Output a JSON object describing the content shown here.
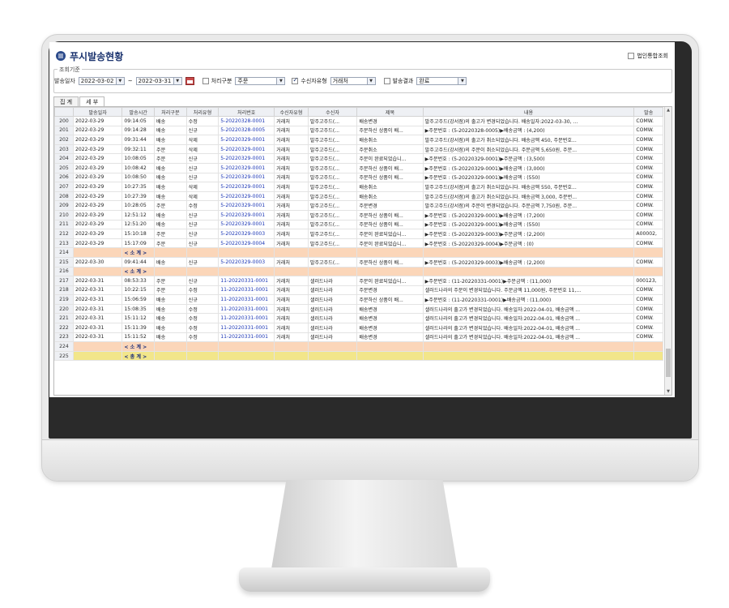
{
  "title": "푸시발송현황",
  "corp_check_label": "법인통합조회",
  "criteria": {
    "legend": "조회기준",
    "send_date_label": "발송일자",
    "date_from": "2022-03-02",
    "date_sep": "~",
    "date_to": "2022-03-31",
    "proc_type_label": "처리구분",
    "proc_type_value": "주문",
    "recipient_type_label": "수신자유형",
    "recipient_type_value": "거래처",
    "result_label": "발송결과",
    "result_value": "완료"
  },
  "tabs": [
    "집 계",
    "세 부"
  ],
  "columns": [
    "",
    "발송일자",
    "발송시간",
    "처리구분",
    "처리유형",
    "처리번호",
    "수신자유형",
    "수신자",
    "제목",
    "내용",
    "발송"
  ],
  "rows": [
    {
      "rn": "200",
      "d": "2022-03-29",
      "t": "09:14:05",
      "pc": "배송",
      "pt": "수정",
      "no": "5-20220328-0001",
      "rt": "거래처",
      "rc": "발주고주드(...",
      "ti": "배송변경",
      "ct": "발주고주드(강서점)의 출고가 변경되었습니다. 배송일자:2022-03-30, ...",
      "sd": "COMW."
    },
    {
      "rn": "201",
      "d": "2022-03-29",
      "t": "09:14:28",
      "pc": "배송",
      "pt": "신규",
      "no": "5-20220328-0005",
      "rt": "거래처",
      "rc": "발주고주드(...",
      "ti": "주문하신 상품이 배...",
      "ct": "▶주문번호 : (5-20220328-0005)▶배송금액 : (4,200)",
      "sd": "COMW."
    },
    {
      "rn": "202",
      "d": "2022-03-29",
      "t": "09:31:44",
      "pc": "배송",
      "pt": "삭제",
      "no": "5-20220329-0001",
      "rt": "거래처",
      "rc": "발주고주드(...",
      "ti": "배송취소",
      "ct": "발주고주드(강서점)의 출고가 취소되었습니다. 배송금액 450, 주문번호...",
      "sd": "COMW."
    },
    {
      "rn": "203",
      "d": "2022-03-29",
      "t": "09:32:11",
      "pc": "주문",
      "pt": "삭제",
      "no": "5-20220329-0001",
      "rt": "거래처",
      "rc": "발주고주드(...",
      "ti": "주문취소",
      "ct": "발주고주드(강서점)의 주문이 취소되었습니다. 주문금액 5,650원, 주문...",
      "sd": "COMW."
    },
    {
      "rn": "204",
      "d": "2022-03-29",
      "t": "10:08:05",
      "pc": "주문",
      "pt": "신규",
      "no": "5-20220329-0001",
      "rt": "거래처",
      "rc": "발주고주드(...",
      "ti": "주문이 완료되었습니...",
      "ct": "▶주문번호 : (5-20220329-0001)▶주문금액 : (3,500)",
      "sd": "COMW."
    },
    {
      "rn": "205",
      "d": "2022-03-29",
      "t": "10:08:42",
      "pc": "배송",
      "pt": "신규",
      "no": "5-20220329-0001",
      "rt": "거래처",
      "rc": "발주고주드(...",
      "ti": "주문하신 상품이 배...",
      "ct": "▶주문번호 : (5-20220329-0001)▶배송금액 : (3,000)",
      "sd": "COMW."
    },
    {
      "rn": "206",
      "d": "2022-03-29",
      "t": "10:08:50",
      "pc": "배송",
      "pt": "신규",
      "no": "5-20220329-0001",
      "rt": "거래처",
      "rc": "발주고주드(...",
      "ti": "주문하신 상품이 배...",
      "ct": "▶주문번호 : (5-20220329-0001)▶배송금액 : (550)",
      "sd": "COMW."
    },
    {
      "rn": "207",
      "d": "2022-03-29",
      "t": "10:27:35",
      "pc": "배송",
      "pt": "삭제",
      "no": "5-20220329-0001",
      "rt": "거래처",
      "rc": "발주고주드(...",
      "ti": "배송취소",
      "ct": "발주고주드(강서점)의 출고가 취소되었습니다. 배송금액 550, 주문번호...",
      "sd": "COMW."
    },
    {
      "rn": "208",
      "d": "2022-03-29",
      "t": "10:27:39",
      "pc": "배송",
      "pt": "삭제",
      "no": "5-20220329-0001",
      "rt": "거래처",
      "rc": "발주고주드(...",
      "ti": "배송취소",
      "ct": "발주고주드(강서점)의 출고가 취소되었습니다. 배송금액 3,000, 주문번...",
      "sd": "COMW."
    },
    {
      "rn": "209",
      "d": "2022-03-29",
      "t": "10:28:05",
      "pc": "주문",
      "pt": "수정",
      "no": "5-20220329-0001",
      "rt": "거래처",
      "rc": "발주고주드(...",
      "ti": "주문변경",
      "ct": "발주고주드(강서점)의 주문이 변경되었습니다. 주문금액 7,750원, 주문...",
      "sd": "COMW."
    },
    {
      "rn": "210",
      "d": "2022-03-29",
      "t": "12:51:12",
      "pc": "배송",
      "pt": "신규",
      "no": "5-20220329-0001",
      "rt": "거래처",
      "rc": "발주고주드(...",
      "ti": "주문하신 상품이 배...",
      "ct": "▶주문번호 : (5-20220329-0001)▶배송금액 : (7,200)",
      "sd": "COMW."
    },
    {
      "rn": "211",
      "d": "2022-03-29",
      "t": "12:51:20",
      "pc": "배송",
      "pt": "신규",
      "no": "5-20220329-0001",
      "rt": "거래처",
      "rc": "발주고주드(...",
      "ti": "주문하신 상품이 배...",
      "ct": "▶주문번호 : (5-20220329-0001)▶배송금액 : (550)",
      "sd": "COMW."
    },
    {
      "rn": "212",
      "d": "2022-03-29",
      "t": "15:10:18",
      "pc": "주문",
      "pt": "신규",
      "no": "5-20220329-0003",
      "rt": "거래처",
      "rc": "발주고주드(...",
      "ti": "주문이 완료되었습니...",
      "ct": "▶주문번호 : (5-20220329-0003)▶주문금액 : (2,200)",
      "sd": "A00002,"
    },
    {
      "rn": "213",
      "d": "2022-03-29",
      "t": "15:17:09",
      "pc": "주문",
      "pt": "신규",
      "no": "5-20220329-0004",
      "rt": "거래처",
      "rc": "발주고주드(...",
      "ti": "주문이 완료되었습니...",
      "ct": "▶주문번호 : (5-20220329-0004)▶주문금액 : (0)",
      "sd": "COMW."
    },
    {
      "rn": "214",
      "kind": "sub",
      "label": "< 소 계 >"
    },
    {
      "rn": "215",
      "d": "2022-03-30",
      "t": "09:41:44",
      "pc": "배송",
      "pt": "신규",
      "no": "5-20220329-0003",
      "rt": "거래처",
      "rc": "발주고주드(...",
      "ti": "주문하신 상품이 배...",
      "ct": "▶주문번호 : (5-20220329-0003)▶배송금액 : (2,200)",
      "sd": "COMW."
    },
    {
      "rn": "216",
      "kind": "sub",
      "label": "< 소 계 >"
    },
    {
      "rn": "217",
      "d": "2022-03-31",
      "t": "08:53:33",
      "pc": "주문",
      "pt": "신규",
      "no": "11-20220331-0001",
      "rt": "거래처",
      "rc": "샐러드나라",
      "ti": "주문이 완료되었습니...",
      "ct": "▶주문번호 : (11-20220331-0001)▶주문금액 : (11,000)",
      "sd": "000123,"
    },
    {
      "rn": "218",
      "d": "2022-03-31",
      "t": "10:22:15",
      "pc": "주문",
      "pt": "수정",
      "no": "11-20220331-0001",
      "rt": "거래처",
      "rc": "샐러드나라",
      "ti": "주문변경",
      "ct": "샐러드나라의 주문이 변경되었습니다. 주문금액 11,000원, 주문번호 11,...",
      "sd": "COMW."
    },
    {
      "rn": "219",
      "d": "2022-03-31",
      "t": "15:06:59",
      "pc": "배송",
      "pt": "신규",
      "no": "11-20220331-0001",
      "rt": "거래처",
      "rc": "샐러드나라",
      "ti": "주문하신 상품이 배...",
      "ct": "▶주문번호 : (11-20220331-0001)▶배송금액 : (11,000)",
      "sd": "COMW."
    },
    {
      "rn": "220",
      "d": "2022-03-31",
      "t": "15:08:35",
      "pc": "배송",
      "pt": "수정",
      "no": "11-20220331-0001",
      "rt": "거래처",
      "rc": "샐러드나라",
      "ti": "배송변경",
      "ct": "샐러드나라의 출고가 변경되었습니다. 배송일자:2022-04-01, 배송금액 ...",
      "sd": "COMW."
    },
    {
      "rn": "221",
      "d": "2022-03-31",
      "t": "15:11:12",
      "pc": "배송",
      "pt": "수정",
      "no": "11-20220331-0001",
      "rt": "거래처",
      "rc": "샐러드나라",
      "ti": "배송변경",
      "ct": "샐러드나라의 출고가 변경되었습니다. 배송일자:2022-04-01, 배송금액 ...",
      "sd": "COMW."
    },
    {
      "rn": "222",
      "d": "2022-03-31",
      "t": "15:11:39",
      "pc": "배송",
      "pt": "수정",
      "no": "11-20220331-0001",
      "rt": "거래처",
      "rc": "샐러드나라",
      "ti": "배송변경",
      "ct": "샐러드나라의 출고가 변경되었습니다. 배송일자:2022-04-01, 배송금액 ...",
      "sd": "COMW."
    },
    {
      "rn": "223",
      "d": "2022-03-31",
      "t": "15:11:52",
      "pc": "배송",
      "pt": "수정",
      "no": "11-20220331-0001",
      "rt": "거래처",
      "rc": "샐러드나라",
      "ti": "배송변경",
      "ct": "샐러드나라의 출고가 변경되었습니다. 배송일자:2022-04-01, 배송금액 ...",
      "sd": "COMW."
    },
    {
      "rn": "224",
      "kind": "sub",
      "label": "< 소 계 >"
    },
    {
      "rn": "225",
      "kind": "total",
      "label": "< 총 계 >"
    }
  ],
  "colors": {
    "title": "#1d3570",
    "subtotal_row": "#fbd6b9",
    "total_row": "#f2e68a",
    "link_number": "#1a35b5"
  }
}
